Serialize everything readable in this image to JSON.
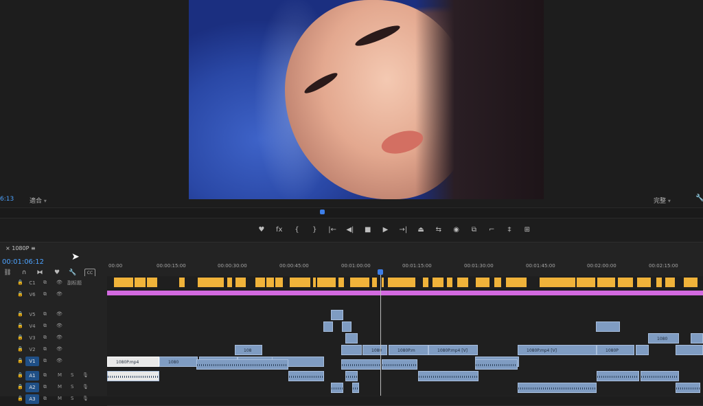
{
  "monitor": {
    "timecode": "6:13",
    "fit_label": "適合",
    "quality_label": "完整",
    "wrench_icon": "wrench-icon"
  },
  "transport": {
    "buttons": [
      {
        "name": "marker-icon",
        "glyph": "♥"
      },
      {
        "name": "fx-icon",
        "glyph": "fx"
      },
      {
        "name": "mark-in-icon",
        "glyph": "{"
      },
      {
        "name": "mark-out-icon",
        "glyph": "}"
      },
      {
        "name": "go-to-in-icon",
        "glyph": "|←"
      },
      {
        "name": "step-back-icon",
        "glyph": "◀|"
      },
      {
        "name": "stop-icon",
        "glyph": "■"
      },
      {
        "name": "play-icon",
        "glyph": "▶"
      },
      {
        "name": "step-forward-icon",
        "glyph": "→|"
      },
      {
        "name": "lift-icon",
        "glyph": "⏏"
      },
      {
        "name": "extract-icon",
        "glyph": "⇆"
      },
      {
        "name": "camera-icon",
        "glyph": "◉"
      },
      {
        "name": "compare-icon",
        "glyph": "⧉"
      },
      {
        "name": "trim-icon",
        "glyph": "⌐"
      },
      {
        "name": "settings-icon",
        "glyph": "‡"
      },
      {
        "name": "export-icon",
        "glyph": "⊞"
      }
    ]
  },
  "timeline": {
    "sequence_name": "1080P",
    "menu_icon": "≡",
    "timecode": "00:01:06:12",
    "ruler": [
      "00:00",
      "00:00:15:00",
      "00:00:30:00",
      "00:00:45:00",
      "00:01:00:00",
      "00:01:15:00",
      "00:01:30:00",
      "00:01:45:00",
      "00:02:00:00",
      "00:02:15:00"
    ],
    "caption_track_label": "副标题",
    "tracks": [
      {
        "id": "C1",
        "label": "C1",
        "selected": false
      },
      {
        "id": "V6",
        "label": "V6",
        "selected": false
      },
      {
        "id": "V5",
        "label": "V5",
        "selected": false
      },
      {
        "id": "V4",
        "label": "V4",
        "selected": false
      },
      {
        "id": "V3",
        "label": "V3",
        "selected": false
      },
      {
        "id": "V2",
        "label": "V2",
        "selected": false
      },
      {
        "id": "V1",
        "label": "V1",
        "selected": true
      },
      {
        "id": "A1",
        "label": "A1",
        "selected": true
      },
      {
        "id": "A2",
        "label": "A2",
        "selected": true
      },
      {
        "id": "A3",
        "label": "A3",
        "selected": true
      }
    ],
    "audio_buttons": {
      "m": "M",
      "s": "S"
    },
    "clips": {
      "V5": [
        {
          "label": ""
        }
      ],
      "V4": [
        {
          "label": ""
        },
        {
          "label": ""
        },
        {
          "label": ""
        }
      ],
      "V3": [
        {
          "label": ""
        },
        {
          "label": "1080"
        },
        {
          "label": ""
        }
      ],
      "V2": [
        {
          "label": "108"
        },
        {
          "label": ""
        },
        {
          "label": "1080"
        },
        {
          "label": "1080P.m"
        },
        {
          "label": "1080P.mp4 [V]"
        },
        {
          "label": "1080P.mp4 [V]"
        },
        {
          "label": "1080P"
        },
        {
          "label": ""
        },
        {
          "label": ""
        }
      ],
      "V1": [
        {
          "label": "1080P.mp4"
        },
        {
          "label": "1080"
        },
        {
          "label": "1080P"
        },
        {
          "label": "1080P.m"
        },
        {
          "label": ""
        },
        {
          "label": "1080P.mp4"
        }
      ]
    }
  },
  "colors": {
    "accent": "#4da3ff",
    "clip_video": "#7f9cc2",
    "caption_bar": "#f0b33a",
    "adjustment_bar": "#d36ae0"
  }
}
